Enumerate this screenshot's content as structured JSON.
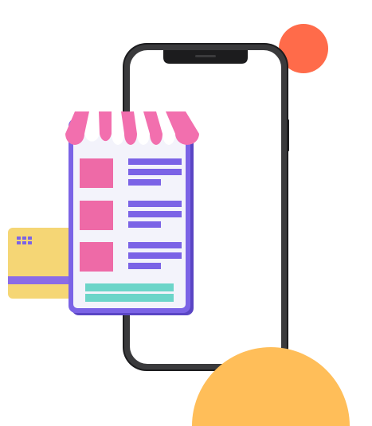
{
  "illustration": {
    "subject": "mobile-shopping",
    "elements": [
      "smartphone",
      "storefront-card",
      "store-awning",
      "product-thumbnails",
      "product-text-lines",
      "buy-button",
      "credit-card",
      "card-chip",
      "decorative-circle",
      "decorative-semicircle"
    ],
    "colors": {
      "phone_frame": "#1c1c1e",
      "phone_screen": "#ffffff",
      "storefront_border": "#7b63e6",
      "storefront_fill": "#f3f3fb",
      "awning_pink": "#f26fae",
      "awning_white": "#ffffff",
      "thumbnail": "#ee6aa7",
      "text_lines": "#7b63e6",
      "button": "#6cd5c9",
      "credit_card": "#f5d675",
      "card_stripe": "#8b6be6",
      "card_chip": "#7b63e6",
      "circle": "#ff6b4a",
      "semicircle": "#ffbe59"
    }
  }
}
